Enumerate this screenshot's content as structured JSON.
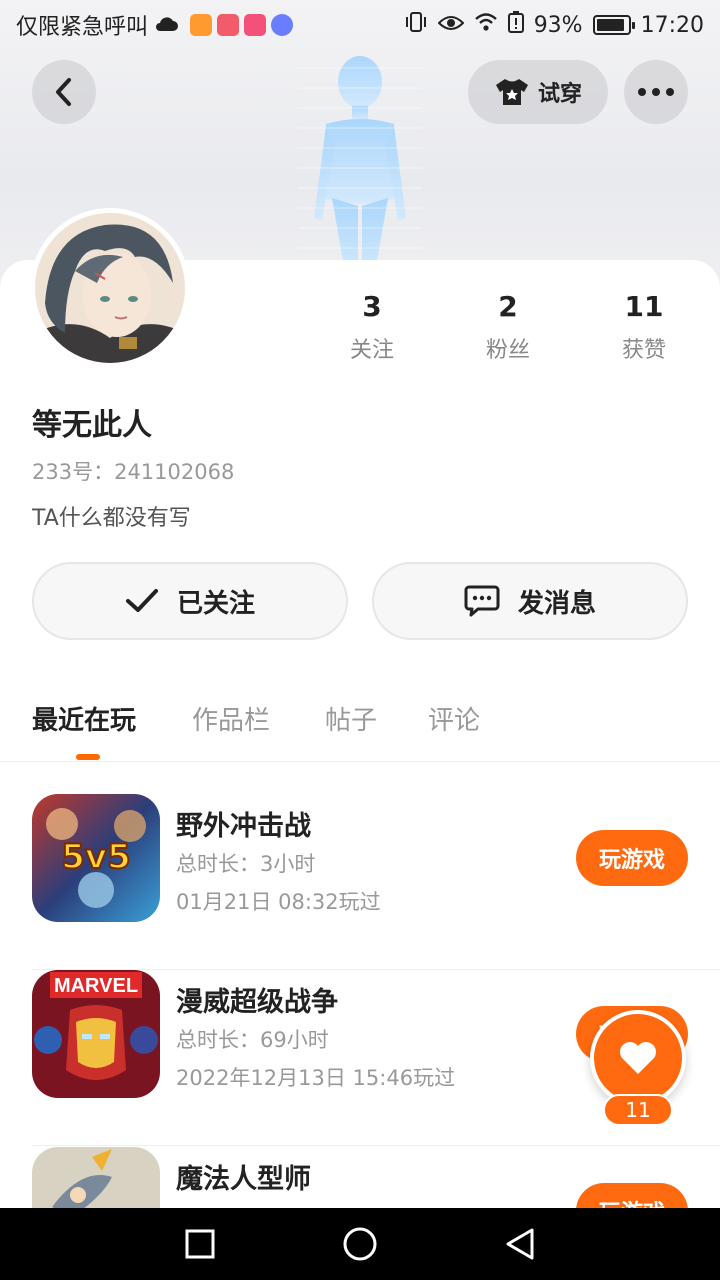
{
  "status_bar": {
    "carrier_text": "仅限紧急呼叫",
    "battery_percent": "93%",
    "time": "17:20",
    "battery_level": 0.93,
    "app_icon_colors": [
      "#ff9a2e",
      "#f25c6a",
      "#f3507a",
      "#6a7cff"
    ]
  },
  "header": {
    "back_icon": "chevron-left-icon",
    "tryon_label": "试穿",
    "tryon_icon": "tshirt-icon",
    "more_icon": "more-dots-icon"
  },
  "profile": {
    "name": "等无此人",
    "uid": "233号：241102068",
    "bio": "TA什么都没有写",
    "stats": [
      {
        "num": "3",
        "label": "关注"
      },
      {
        "num": "2",
        "label": "粉丝"
      },
      {
        "num": "11",
        "label": "获赞"
      }
    ]
  },
  "actions": {
    "follow_label": "已关注",
    "message_label": "发消息"
  },
  "tabs": [
    "最近在玩",
    "作品栏",
    "帖子",
    "评论"
  ],
  "games": [
    {
      "title": "野外冲击战",
      "duration": "总时长：3小时",
      "last_played": "01月21日 08:32玩过",
      "button": "玩游戏",
      "icon_text": "5v5"
    },
    {
      "title": "漫威超级战争",
      "duration": "总时长：69小时",
      "last_played": "2022年12月13日 15:46玩过",
      "button": "玩游戏",
      "icon_text": "MARVEL"
    },
    {
      "title": "魔法人型师",
      "duration": "",
      "last_played": "",
      "button": "玩游戏",
      "icon_text": ""
    }
  ],
  "like_fab": {
    "count": "11",
    "icon": "heart-icon"
  },
  "colors": {
    "accent": "#ff6a10"
  }
}
